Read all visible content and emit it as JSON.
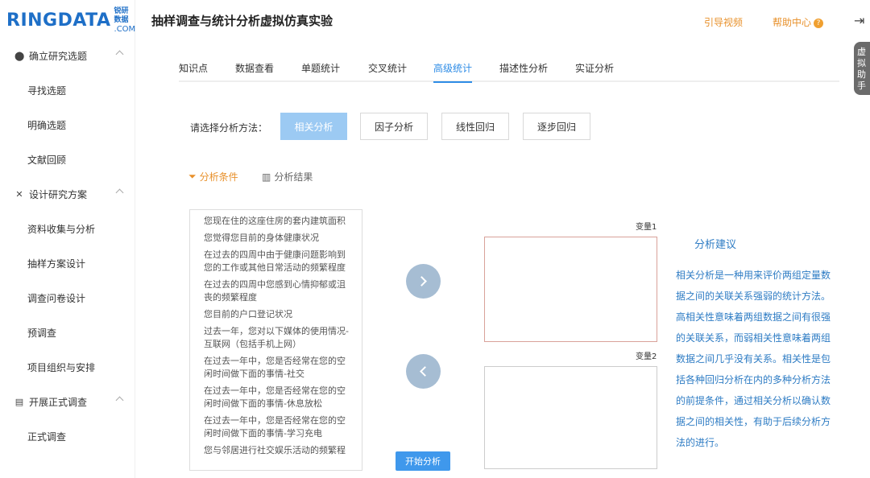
{
  "brand": {
    "logo_main": "RINGDATA",
    "logo_cn": "锐研数据",
    "logo_com": ".COM"
  },
  "header": {
    "title": "抽样调查与统计分析虚拟仿真实验",
    "guide_video": "引导视频",
    "help_center": "帮助中心",
    "help_mark": "?",
    "exit_icon": "exit-icon",
    "helper_text": "虚拟助手"
  },
  "sidebar": {
    "groups": [
      {
        "label": "确立研究选题",
        "icon": "location-pin-icon",
        "items": [
          "寻找选题",
          "明确选题",
          "文献回顾"
        ]
      },
      {
        "label": "设计研究方案",
        "icon": "tools-icon",
        "items": [
          "资料收集与分析",
          "抽样方案设计",
          "调查问卷设计",
          "预调查",
          "项目组织与安排"
        ]
      },
      {
        "label": "开展正式调查",
        "icon": "document-icon",
        "items": [
          "正式调查"
        ]
      }
    ]
  },
  "tabs": [
    "知识点",
    "数据查看",
    "单题统计",
    "交叉统计",
    "高级统计",
    "描述性分析",
    "实证分析"
  ],
  "active_tab": "高级统计",
  "method": {
    "label": "请选择分析方法：",
    "options": [
      "相关分析",
      "因子分析",
      "线性回归",
      "逐步回归"
    ],
    "selected": "相关分析"
  },
  "subtabs": {
    "conditions": "分析条件",
    "results": "分析结果"
  },
  "variables": [
    "您现在住的这座住房的套内建筑面积",
    "您觉得您目前的身体健康状况",
    "在过去的四周中由于健康问题影响到您的工作或其他日常活动的频繁程度",
    "在过去的四周中您感到心情抑郁或沮丧的频繁程度",
    "您目前的户口登记状况",
    "过去一年，您对以下媒体的使用情况-互联网（包括手机上网）",
    "在过去一年中，您是否经常在您的空闲时间做下面的事情-社交",
    "在过去一年中，您是否经常在您的空闲时间做下面的事情-休息放松",
    "在过去一年中，您是否经常在您的空闲时间做下面的事情-学习充电",
    "您与邻居进行社交娱乐活动的频繁程"
  ],
  "var1_label": "变量1",
  "var2_label": "变量2",
  "start_button": "开始分析",
  "advice": {
    "title": "分析建议",
    "text": "相关分析是一种用来评价两组定量数据之间的关联关系强弱的统计方法。高相关性意味着两组数据之间有很强的关联关系，而弱相关性意味着两组数据之间几乎没有关系。相关性是包括各种回归分析在内的多种分析方法的前提条件，通过相关分析以确认数据之间的相关性，有助于后续分析方法的进行。"
  },
  "colors": {
    "accent": "#2e8ce6",
    "orange": "#e8902a",
    "selected_button": "#9ccaf3",
    "advice_text": "#2e7cc4"
  }
}
